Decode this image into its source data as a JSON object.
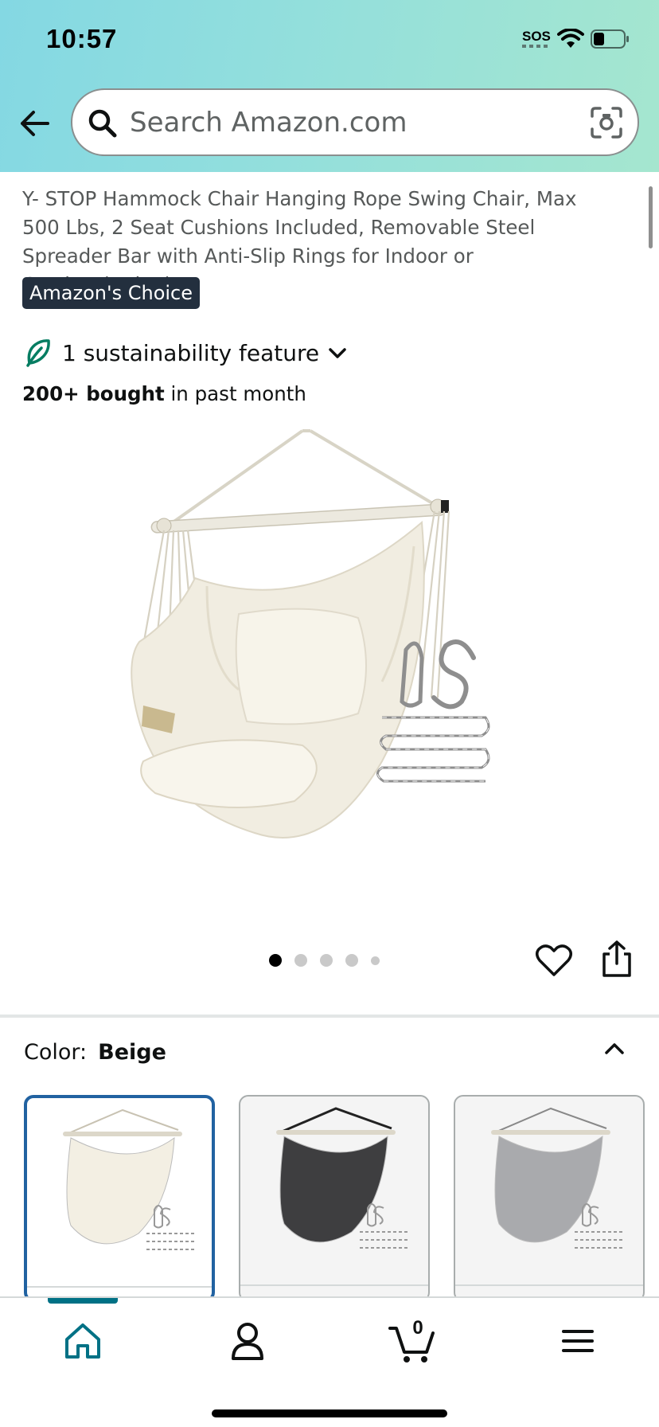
{
  "status_bar": {
    "time": "10:57",
    "sos": "SOS"
  },
  "search": {
    "placeholder": "Search Amazon.com"
  },
  "product": {
    "title": "Y- STOP Hammock Chair Hanging Rope Swing Chair, Max 500 Lbs, 2 Seat Cushions Included, Removable Steel Spreader Bar with Anti-Slip Rings for Indoor or Outdoor(Beige)",
    "badge": "Amazon's Choice",
    "sustainability": "1 sustainability feature",
    "bought_count": "200+ bought",
    "bought_suffix": " in past month"
  },
  "gallery": {
    "image_count": 5,
    "active_index": 0
  },
  "variation": {
    "label": "Color:",
    "value": "Beige",
    "swatch_colors": [
      "#f3efe3",
      "#3e3e40",
      "#a9aaad"
    ]
  },
  "cart": {
    "count": "0"
  },
  "colors": {
    "header_start": "#84d8e3",
    "header_end": "#a5e6cf",
    "badge_bg": "#232f3e",
    "selected_border": "#2162a1",
    "nav_accent": "#007185",
    "leaf": "#067d62"
  }
}
